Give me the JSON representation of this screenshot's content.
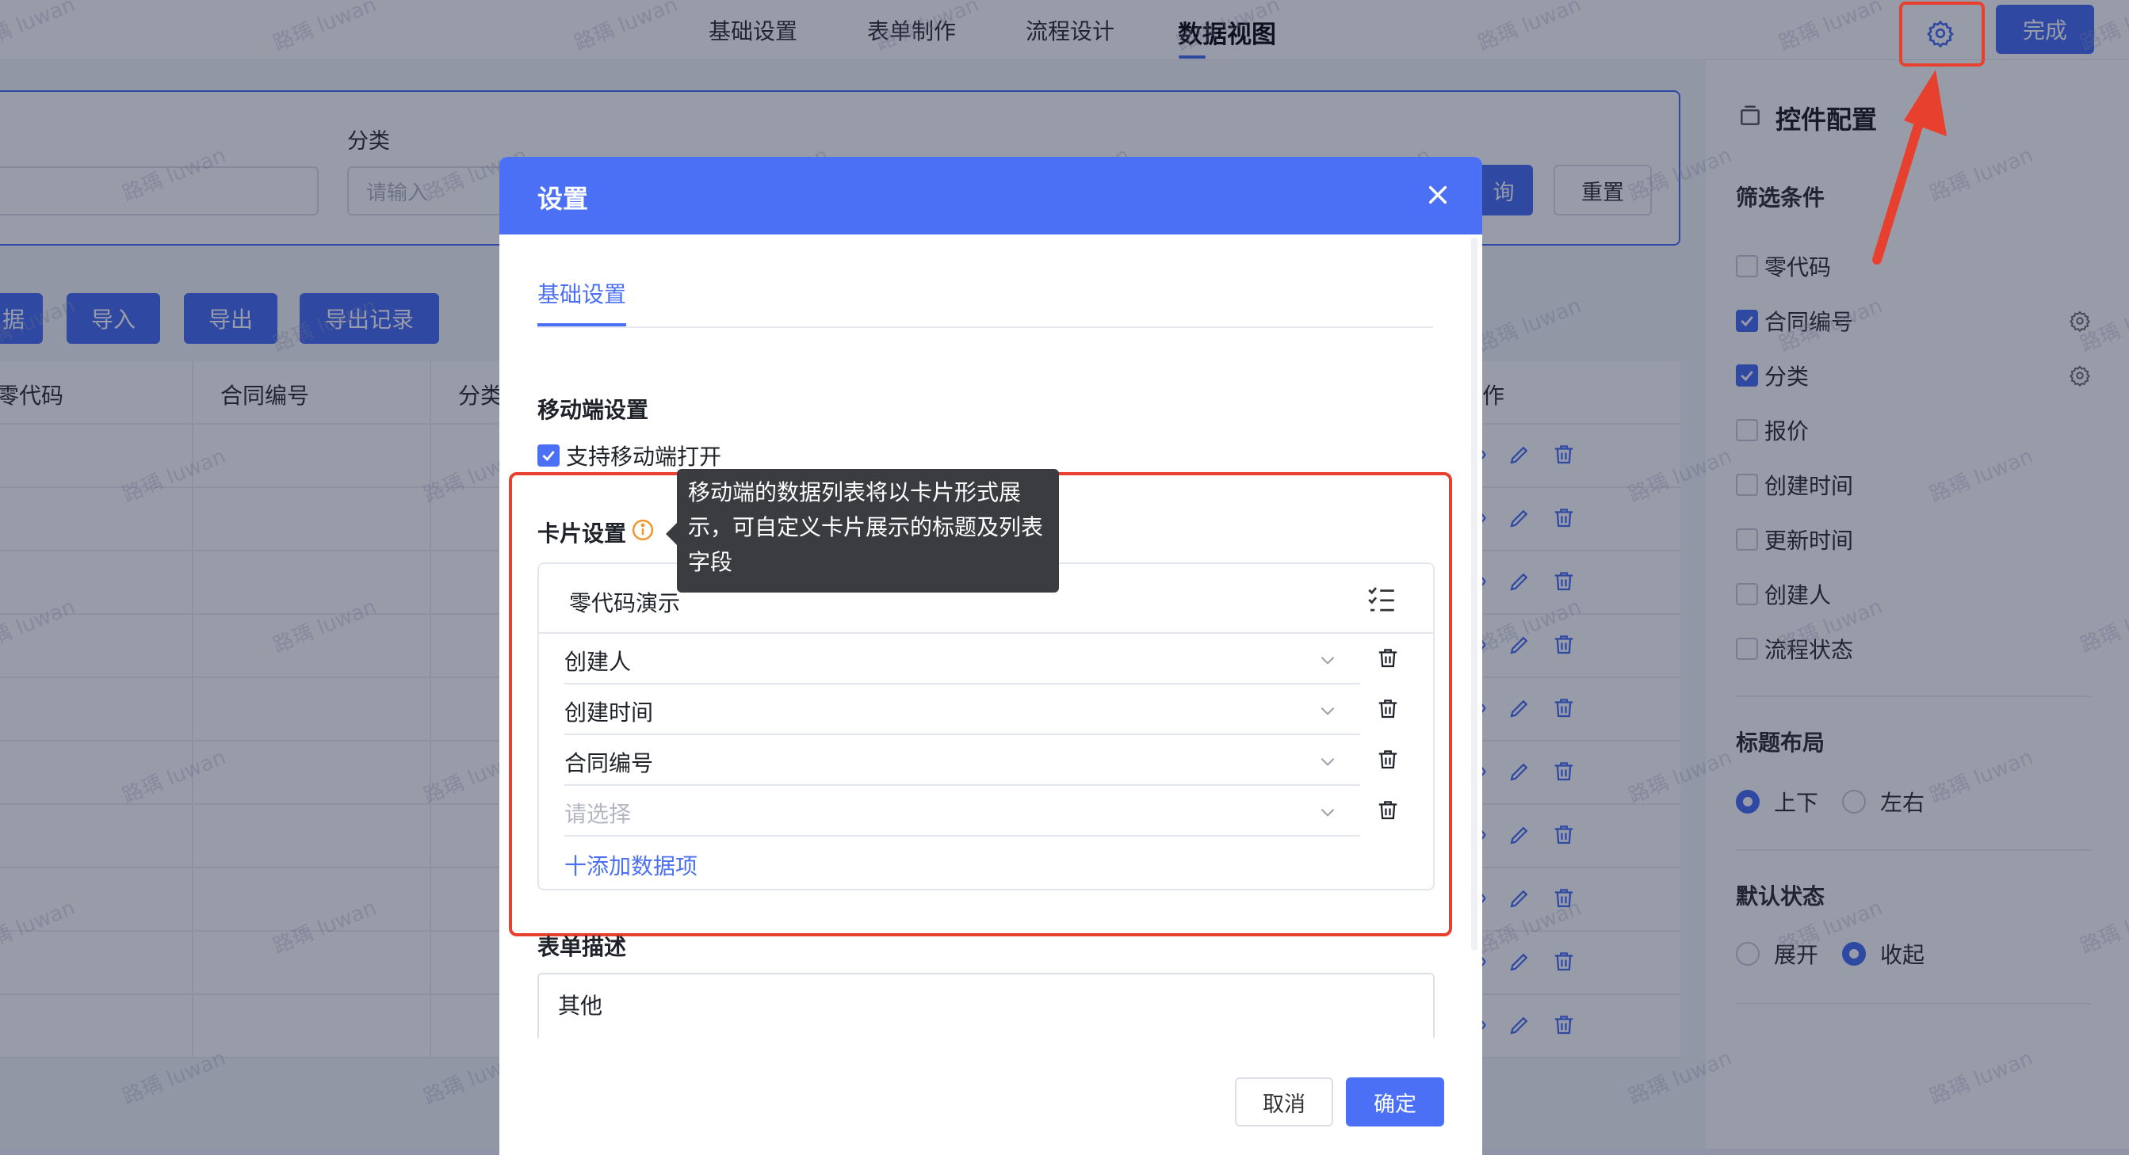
{
  "nav": {
    "tabs": [
      "基础设置",
      "表单制作",
      "流程设计",
      "数据视图"
    ],
    "active_index": 3,
    "done_label": "完成"
  },
  "filter": {
    "category_label": "分类",
    "category_placeholder": "请输入",
    "query_label": "询",
    "reset_label": "重置"
  },
  "toolbar": {
    "buttons": [
      "据",
      "导入",
      "导出",
      "导出记录"
    ]
  },
  "table": {
    "columns": [
      "零代码",
      "合同编号",
      "分类",
      "作"
    ]
  },
  "right_panel": {
    "title": "控件配置",
    "filter_section": "筛选条件",
    "filter_items": [
      {
        "label": "零代码",
        "checked": false,
        "has_gear": false
      },
      {
        "label": "合同编号",
        "checked": true,
        "has_gear": true
      },
      {
        "label": "分类",
        "checked": true,
        "has_gear": true
      },
      {
        "label": "报价",
        "checked": false,
        "has_gear": false
      },
      {
        "label": "创建时间",
        "checked": false,
        "has_gear": false
      },
      {
        "label": "更新时间",
        "checked": false,
        "has_gear": false
      },
      {
        "label": "创建人",
        "checked": false,
        "has_gear": false
      },
      {
        "label": "流程状态",
        "checked": false,
        "has_gear": false
      }
    ],
    "title_layout_section": "标题布局",
    "title_layout_options": [
      "上下",
      "左右"
    ],
    "title_layout_selected": "上下",
    "default_state_section": "默认状态",
    "default_state_options": [
      "展开",
      "收起"
    ],
    "default_state_selected": "收起"
  },
  "modal": {
    "title": "设置",
    "tab_label": "基础设置",
    "mobile_section": "移动端设置",
    "mobile_checkbox_label": "支持移动端打开",
    "mobile_checked": true,
    "card_section": "卡片设置",
    "tooltip": "移动端的数据列表将以卡片形式展示，可自定义卡片展示的标题及列表字段",
    "card_title": "零代码演示",
    "card_fields": [
      "创建人",
      "创建时间",
      "合同编号"
    ],
    "card_field_placeholder": "请选择",
    "add_item_label": "十添加数据项",
    "desc_section": "表单描述",
    "desc_value": "其他",
    "cancel_label": "取消",
    "ok_label": "确定"
  },
  "watermark_text": "路瑀 luwan",
  "colors": {
    "primary": "#4b70f5",
    "annotation_red": "#e8402f",
    "tooltip_bg": "#3a3c40"
  }
}
